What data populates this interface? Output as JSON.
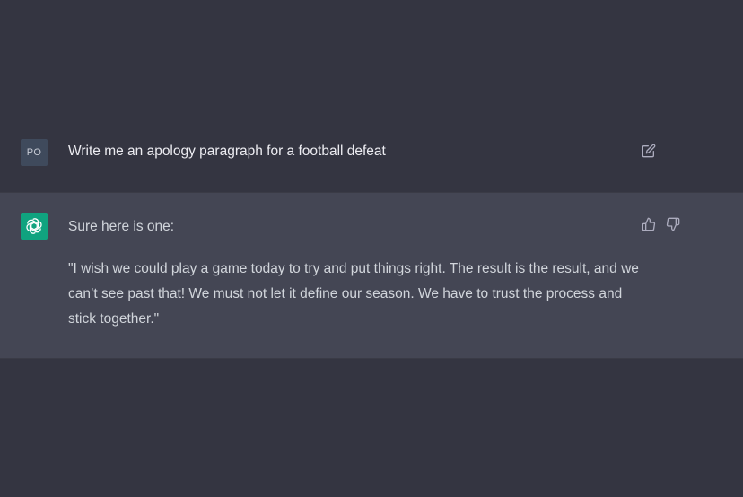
{
  "conversation": {
    "user": {
      "avatar_initials": "PO",
      "message": "Write me an apology paragraph for a football defeat",
      "actions": [
        "edit-icon"
      ]
    },
    "assistant": {
      "intro": "Sure here is one:",
      "body": "\"I wish we could play a game today to try and put things right. The result is the result, and we can’t see past that! We must not let it define our season. We have to trust the process and stick together.\"",
      "actions": [
        "thumbs-up-icon",
        "thumbs-down-icon"
      ],
      "avatar_icon": "openai-logo-icon"
    }
  },
  "colors": {
    "background": "#343541",
    "assistant_background": "#444654",
    "assistant_avatar": "#10a37f",
    "user_avatar": "#3f4a5c"
  }
}
